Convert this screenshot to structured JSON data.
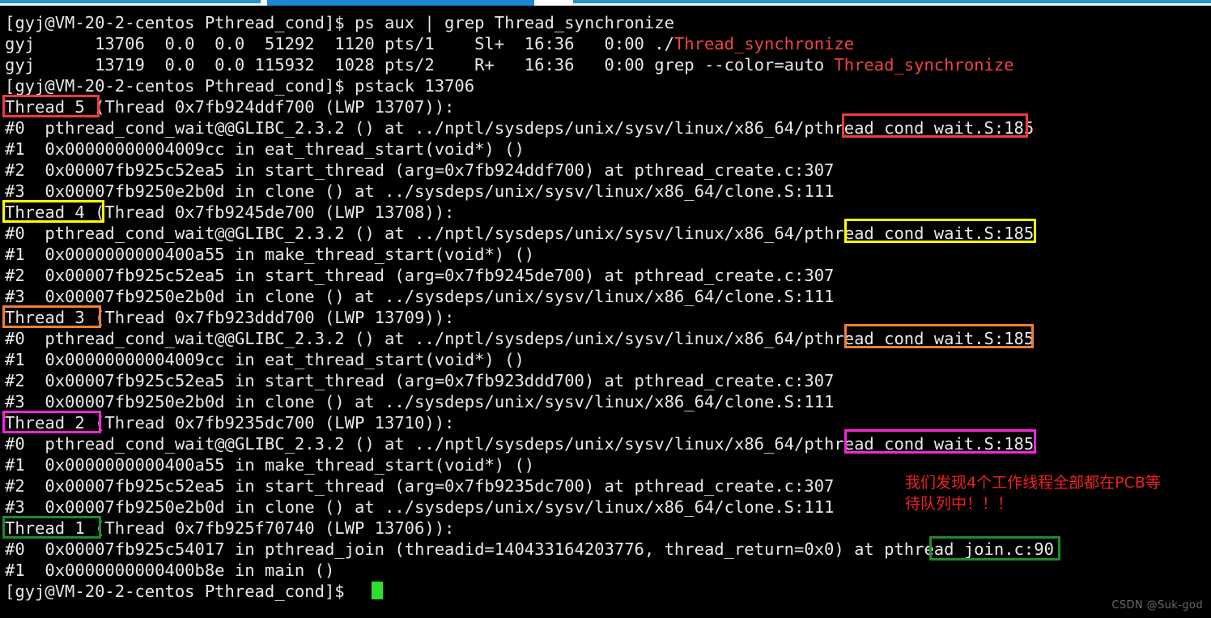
{
  "terminal": {
    "prompt": "[gyj@VM-20-2-centos Pthread_cond]$ ",
    "lines": [
      {
        "id": "l00",
        "text": "[gyj@VM-20-2-centos Pthread_cond]$ ps aux | grep Thread_synchronize"
      },
      {
        "id": "l01",
        "text": "gyj      13706  0.0  0.0  51292  1120 pts/1    Sl+  16:36   0:00 ./"
      },
      {
        "id": "l01b",
        "text": "Thread_synchronize",
        "color": "red"
      },
      {
        "id": "l02",
        "text": "gyj      13719  0.0  0.0 115932  1028 pts/2    R+   16:36   0:00 grep --color=auto "
      },
      {
        "id": "l02b",
        "text": "Thread_synchronize",
        "color": "red"
      },
      {
        "id": "l03",
        "text": "[gyj@VM-20-2-centos Pthread_cond]$ pstack 13706"
      },
      {
        "id": "l04",
        "text": "Thread 5 (Thread 0x7fb924ddf700 (LWP 13707)):"
      },
      {
        "id": "l05",
        "text": "#0  pthread_cond_wait@@GLIBC_2.3.2 () at ../nptl/sysdeps/unix/sysv/linux/x86_64/pthread_cond_wait.S:185"
      },
      {
        "id": "l06",
        "text": "#1  0x00000000004009cc in eat_thread_start(void*) ()"
      },
      {
        "id": "l07",
        "text": "#2  0x00007fb925c52ea5 in start_thread (arg=0x7fb924ddf700) at pthread_create.c:307"
      },
      {
        "id": "l08",
        "text": "#3  0x00007fb9250e2b0d in clone () at ../sysdeps/unix/sysv/linux/x86_64/clone.S:111"
      },
      {
        "id": "l09",
        "text": "Thread 4 (Thread 0x7fb9245de700 (LWP 13708)):"
      },
      {
        "id": "l10",
        "text": "#0  pthread_cond_wait@@GLIBC_2.3.2 () at ../nptl/sysdeps/unix/sysv/linux/x86_64/pthread_cond_wait.S:185"
      },
      {
        "id": "l11",
        "text": "#1  0x0000000000400a55 in make_thread_start(void*) ()"
      },
      {
        "id": "l12",
        "text": "#2  0x00007fb925c52ea5 in start_thread (arg=0x7fb9245de700) at pthread_create.c:307"
      },
      {
        "id": "l13",
        "text": "#3  0x00007fb9250e2b0d in clone () at ../sysdeps/unix/sysv/linux/x86_64/clone.S:111"
      },
      {
        "id": "l14",
        "text": "Thread 3 (Thread 0x7fb923ddd700 (LWP 13709)):"
      },
      {
        "id": "l15",
        "text": "#0  pthread_cond_wait@@GLIBC_2.3.2 () at ../nptl/sysdeps/unix/sysv/linux/x86_64/pthread_cond_wait.S:185"
      },
      {
        "id": "l16",
        "text": "#1  0x00000000004009cc in eat_thread_start(void*) ()"
      },
      {
        "id": "l17",
        "text": "#2  0x00007fb925c52ea5 in start_thread (arg=0x7fb923ddd700) at pthread_create.c:307"
      },
      {
        "id": "l18",
        "text": "#3  0x00007fb9250e2b0d in clone () at ../sysdeps/unix/sysv/linux/x86_64/clone.S:111"
      },
      {
        "id": "l19",
        "text": "Thread 2 (Thread 0x7fb9235dc700 (LWP 13710)):"
      },
      {
        "id": "l20",
        "text": "#0  pthread_cond_wait@@GLIBC_2.3.2 () at ../nptl/sysdeps/unix/sysv/linux/x86_64/pthread_cond_wait.S:185"
      },
      {
        "id": "l21",
        "text": "#1  0x0000000000400a55 in make_thread_start(void*) ()"
      },
      {
        "id": "l22",
        "text": "#2  0x00007fb925c52ea5 in start_thread (arg=0x7fb9235dc700) at pthread_create.c:307"
      },
      {
        "id": "l23",
        "text": "#3  0x00007fb9250e2b0d in clone () at ../sysdeps/unix/sysv/linux/x86_64/clone.S:111"
      },
      {
        "id": "l24",
        "text": "Thread 1 (Thread 0x7fb925f70740 (LWP 13706)):"
      },
      {
        "id": "l25",
        "text": "#0  0x00007fb925c54017 in pthread_join (threadid=140433164203776, thread_return=0x0) at pthread_join.c:90"
      },
      {
        "id": "l26",
        "text": "#1  0x0000000000400b8e in main ()"
      },
      {
        "id": "l27",
        "text": "[gyj@VM-20-2-centos Pthread_cond]$ "
      }
    ]
  },
  "commands": {
    "ps_command": "ps aux | grep Thread_synchronize",
    "pstack_command": "pstack 13706",
    "target_pid": "13706",
    "program_name": "Thread_synchronize"
  },
  "ps_table": {
    "rows": [
      {
        "user": "gyj",
        "pid": "13706",
        "cpu": "0.0",
        "mem": "0.0",
        "vsz": "51292",
        "rss": "1120",
        "tty": "pts/1",
        "stat": "Sl+",
        "start": "16:36",
        "time": "0:00",
        "command": "./Thread_synchronize"
      },
      {
        "user": "gyj",
        "pid": "13719",
        "cpu": "0.0",
        "mem": "0.0",
        "vsz": "115932",
        "rss": "1028",
        "tty": "pts/2",
        "stat": "R+",
        "start": "16:36",
        "time": "0:00",
        "command": "grep --color=auto Thread_synchronize"
      }
    ]
  },
  "threads": [
    {
      "label": "Thread 5",
      "tid": "0x7fb924ddf700",
      "lwp": "13707",
      "box_color": "#f23a3a",
      "top_frame": "pthread_cond_wait"
    },
    {
      "label": "Thread 4",
      "tid": "0x7fb9245de700",
      "lwp": "13708",
      "box_color": "#ffff00",
      "top_frame": "pthread_cond_wait"
    },
    {
      "label": "Thread 3",
      "tid": "0x7fb923ddd700",
      "lwp": "13709",
      "box_color": "#f08030",
      "top_frame": "pthread_cond_wait"
    },
    {
      "label": "Thread 2",
      "tid": "0x7fb9235dc700",
      "lwp": "13710",
      "box_color": "#ff22dd",
      "top_frame": "pthread_cond_wait"
    },
    {
      "label": "Thread 1",
      "tid": "0x7fb925f70740",
      "lwp": "13706",
      "box_color": "#1f8b28",
      "top_frame": "pthread_join"
    }
  ],
  "annotation": {
    "text": "我们发现4个工作线程全部都在PCB等\n待队列中！！！",
    "color": "#f02020"
  },
  "watermark": {
    "text": "CSDN @Suk-god"
  },
  "colors": {
    "background": "#000000",
    "foreground": "#e8e8e8",
    "red": "#ef4545",
    "green": "#2ee02e",
    "cursor": "#2ee02e"
  }
}
